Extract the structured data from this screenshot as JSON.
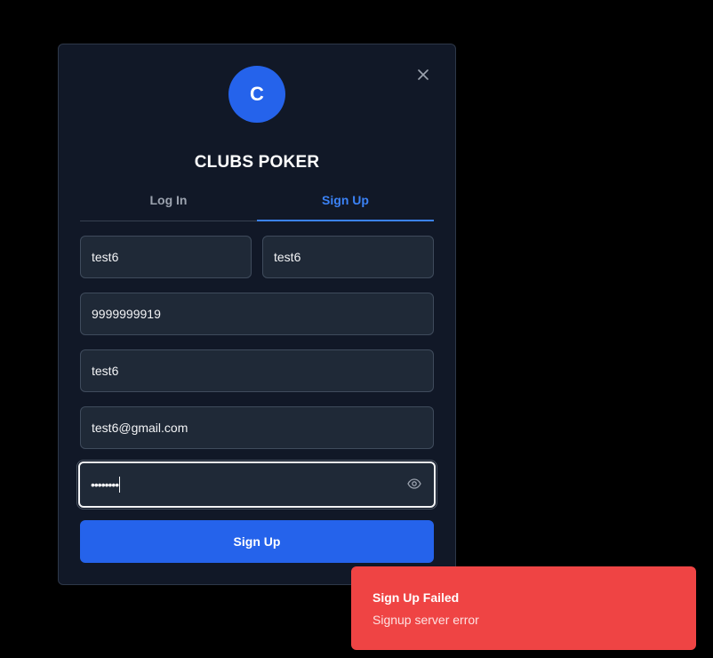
{
  "modal": {
    "avatar_letter": "C",
    "title": "CLUBS POKER",
    "tabs": [
      {
        "label": "Log In",
        "active": false
      },
      {
        "label": "Sign Up",
        "active": true
      }
    ],
    "fields": {
      "first_name": "test6",
      "last_name": "test6",
      "phone": "9999999919",
      "username": "test6",
      "email": "test6@gmail.com",
      "password_mask": "••••••••"
    },
    "submit_label": "Sign Up",
    "icons": {
      "close": "close-icon",
      "eye": "eye-icon"
    }
  },
  "toast": {
    "title": "Sign Up Failed",
    "description": "Signup server error",
    "color": "#ef4444"
  },
  "colors": {
    "accent": "#2563eb",
    "background": "#000000",
    "panel": "#111827",
    "field": "#1f2937"
  }
}
